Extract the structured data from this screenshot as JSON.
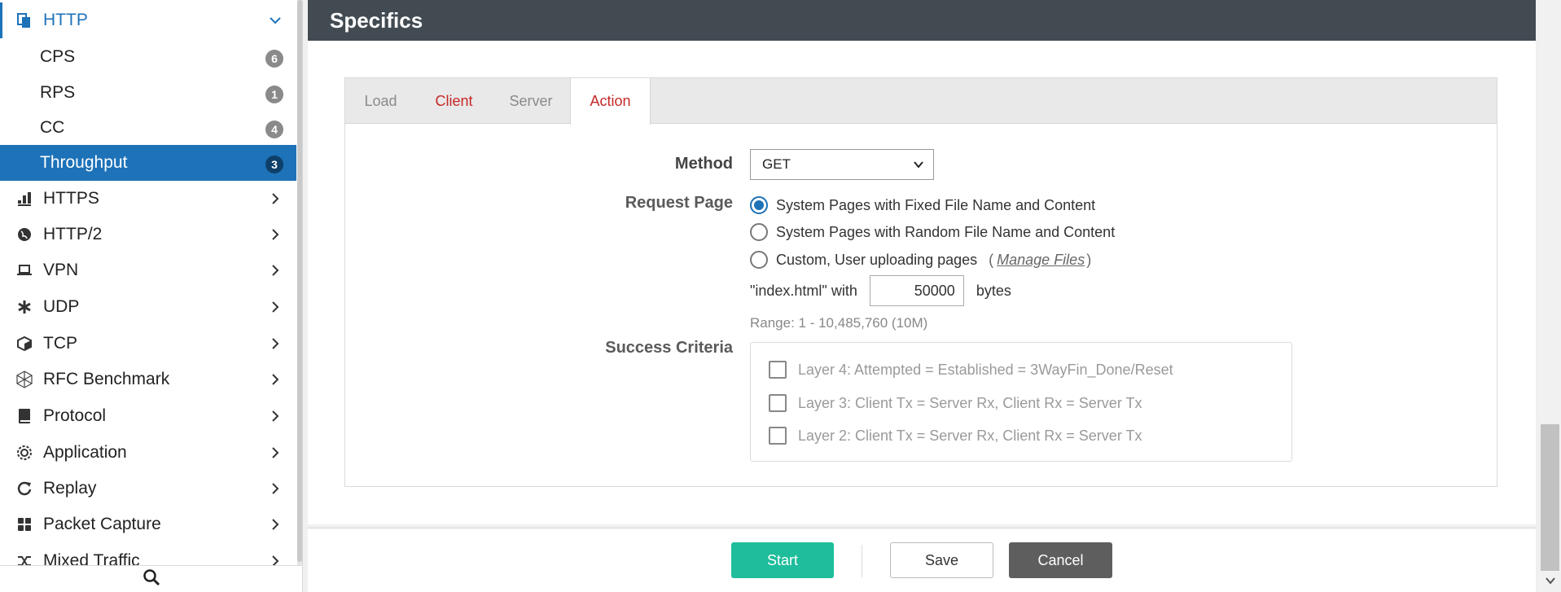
{
  "sidebar": {
    "group_http": {
      "label": "HTTP",
      "icon": "http-copy-icon"
    },
    "sub_items": [
      {
        "label": "CPS",
        "badge": "6"
      },
      {
        "label": "RPS",
        "badge": "1"
      },
      {
        "label": "CC",
        "badge": "4"
      },
      {
        "label": "Throughput",
        "badge": "3"
      }
    ],
    "groups": [
      {
        "label": "HTTPS",
        "icon": "bars-icon"
      },
      {
        "label": "HTTP/2",
        "icon": "globe-icon"
      },
      {
        "label": "VPN",
        "icon": "laptop-icon"
      },
      {
        "label": "UDP",
        "icon": "asterisk-icon"
      },
      {
        "label": "TCP",
        "icon": "cube-icon"
      },
      {
        "label": "RFC Benchmark",
        "icon": "network-icon"
      },
      {
        "label": "Protocol",
        "icon": "book-icon"
      },
      {
        "label": "Application",
        "icon": "gear-icon"
      },
      {
        "label": "Replay",
        "icon": "replay-icon"
      },
      {
        "label": "Packet Capture",
        "icon": "grid-icon"
      },
      {
        "label": "Mixed Traffic",
        "icon": "shuffle-icon"
      }
    ],
    "search_icon": "search-icon"
  },
  "header": {
    "title": "Specifics"
  },
  "tabs": [
    {
      "label": "Load"
    },
    {
      "label": "Client"
    },
    {
      "label": "Server"
    },
    {
      "label": "Action"
    }
  ],
  "form": {
    "method_label": "Method",
    "method_value": "GET",
    "request_page_label": "Request Page",
    "radio_options": [
      "System Pages with Fixed File Name and Content",
      "System Pages with Random File Name and Content",
      "Custom, User uploading pages"
    ],
    "paren_open": "(",
    "manage_files": "Manage Files",
    "paren_close": ")",
    "index_prefix": "\"index.html\" with",
    "size_value": "50000",
    "size_unit": "bytes",
    "range_note": "Range: 1 - 10,485,760 (10M)",
    "success_label": "Success Criteria",
    "criteria": [
      "Layer 4: Attempted = Established = 3WayFin_Done/Reset",
      "Layer 3: Client Tx = Server Rx, Client Rx = Server Tx",
      "Layer 2: Client Tx = Server Rx, Client Rx = Server Tx"
    ]
  },
  "footer": {
    "start": "Start",
    "save": "Save",
    "cancel": "Cancel"
  },
  "colors": {
    "accent": "#1d72b8",
    "header_bg": "#424b52",
    "start_green": "#1ebd9b",
    "tab_red": "#c62828"
  }
}
